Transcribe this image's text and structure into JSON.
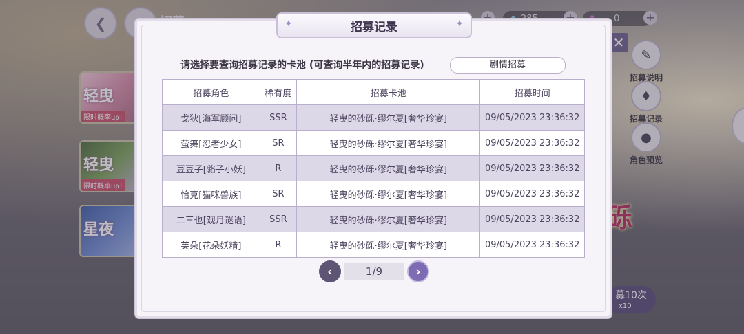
{
  "hud": {
    "back_icon": "chevron-left-icon",
    "home_icon": "home-icon",
    "nav_title": "招募",
    "currency_1": "285",
    "currency_2": "0"
  },
  "banners": [
    {
      "title": "轻曳",
      "tag": "限时概率up!"
    },
    {
      "title": "轻曳",
      "tag": "限时概率up!"
    },
    {
      "title": "星夜",
      "tag": ""
    }
  ],
  "side_menu": [
    {
      "label": "招募说明",
      "icon": "clipboard-icon"
    },
    {
      "label": "招募记录",
      "icon": "cards-icon"
    },
    {
      "label": "角色预览",
      "icon": "person-icon"
    }
  ],
  "char_art_text": "砾",
  "pull_ten": {
    "label": "募10次",
    "cost": "x10"
  },
  "modal": {
    "title": "招募记录",
    "prompt": "请选择要查询招募记录的卡池 (可查询半年内的招募记录)",
    "pool_selected": "剧情招募",
    "columns": [
      "招募角色",
      "稀有度",
      "招募卡池",
      "招募时间"
    ],
    "rows": [
      {
        "character": "戈狄[海军顾问]",
        "rarity": "SSR",
        "pool": "轻曳的砂砾·缪尔夏[奢华珍宴]",
        "time": "09/05/2023 23:36:32"
      },
      {
        "character": "萤舞[忍者少女]",
        "rarity": "SR",
        "pool": "轻曳的砂砾·缪尔夏[奢华珍宴]",
        "time": "09/05/2023 23:36:32"
      },
      {
        "character": "豆豆子[貉子小妖]",
        "rarity": "R",
        "pool": "轻曳的砂砾·缪尔夏[奢华珍宴]",
        "time": "09/05/2023 23:36:32"
      },
      {
        "character": "恰克[猫咪兽族]",
        "rarity": "SR",
        "pool": "轻曳的砂砾·缪尔夏[奢华珍宴]",
        "time": "09/05/2023 23:36:32"
      },
      {
        "character": "二三也[观月谜语]",
        "rarity": "SSR",
        "pool": "轻曳的砂砾·缪尔夏[奢华珍宴]",
        "time": "09/05/2023 23:36:32"
      },
      {
        "character": "芙朵[花朵妖精]",
        "rarity": "R",
        "pool": "轻曳的砂砾·缪尔夏[奢华珍宴]",
        "time": "09/05/2023 23:36:32"
      }
    ],
    "page": "1/9"
  },
  "colors": {
    "accent": "#7e6bb3",
    "row_alt": "#ddd8e8",
    "close": "#6b5f8c"
  }
}
